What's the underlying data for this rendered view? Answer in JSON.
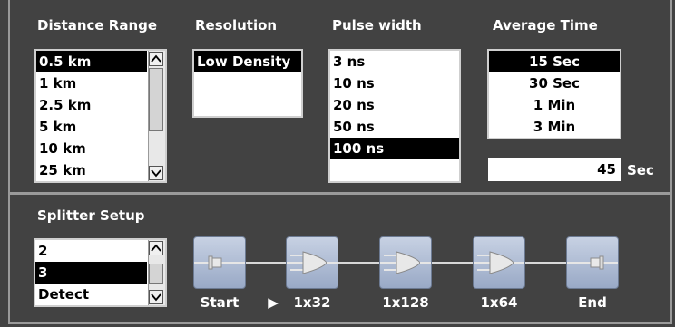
{
  "distance_range": {
    "title": "Distance Range",
    "items": [
      "0.5 km",
      "1 km",
      "2.5 km",
      "5 km",
      "10 km",
      "25 km"
    ],
    "selected": "0.5 km"
  },
  "resolution": {
    "title": "Resolution",
    "items": [
      "Low Density"
    ],
    "selected": "Low Density"
  },
  "pulse_width": {
    "title": "Pulse width",
    "items": [
      "3 ns",
      "10 ns",
      "20 ns",
      "50 ns",
      "100 ns"
    ],
    "selected": "100 ns"
  },
  "average_time": {
    "title": "Average Time",
    "items": [
      "15 Sec",
      "30 Sec",
      "1 Min",
      "3 Min"
    ],
    "selected": "15 Sec",
    "value": "45",
    "unit": "Sec"
  },
  "splitter_setup": {
    "title": "Splitter Setup",
    "items": [
      "2",
      "3",
      "Detect"
    ],
    "selected": "3",
    "chain": [
      "Start",
      "1x32",
      "1x128",
      "1x64",
      "End"
    ],
    "current_marker": "▶"
  },
  "colors": {
    "panel_bg": "#424242",
    "selection": "#000000",
    "node_bg": "#b3bfd6"
  },
  "icons": [
    "scroll-up-arrow-icon",
    "scroll-down-arrow-icon",
    "connector-plug-icon",
    "splitter-icon",
    "play-marker-icon"
  ]
}
